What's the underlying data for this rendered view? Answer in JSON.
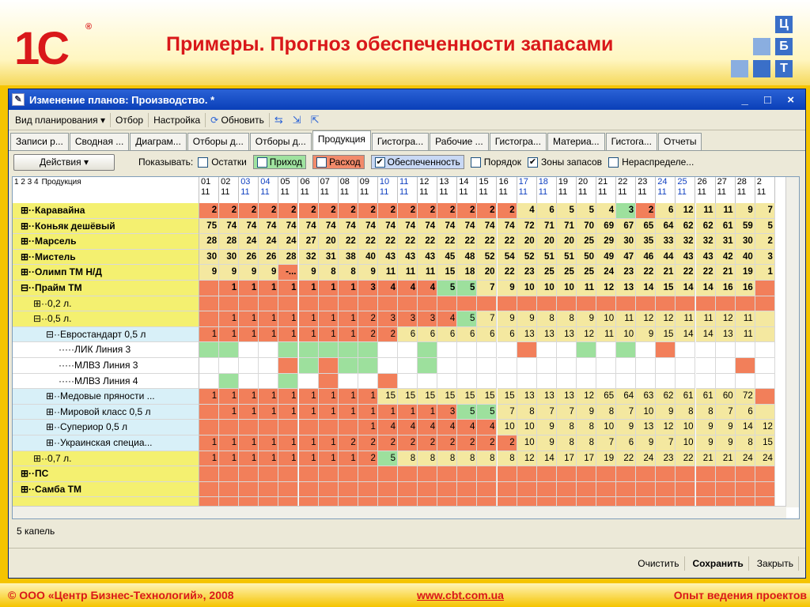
{
  "slide": {
    "logo": "1С",
    "title": "Примеры. Прогноз обеспеченности запасами",
    "cbt": [
      "Ц",
      "Б",
      "Т"
    ],
    "footer_left_pre": "© ООО «",
    "footer_left_bold": "Центр Бизнес-Технологий",
    "footer_left_post": "», 2008",
    "footer_center": "www.cbt.com.ua",
    "footer_right": "Опыт ведения проектов"
  },
  "window": {
    "title": "Изменение планов: Производство.  *",
    "controls": "_ □ ×"
  },
  "menubar": [
    "Вид планирования ▾",
    "Отбор",
    "Настройка",
    "Обновить"
  ],
  "tabs": [
    "Записи р...",
    "Сводная ...",
    "Диаграм...",
    "Отборы д...",
    "Отборы д...",
    "Продукция",
    "Гистогра...",
    "Рабочие ...",
    "Гистогра...",
    "Материа...",
    "Гистога...",
    "Отчеты"
  ],
  "active_tab": 5,
  "filterbar": {
    "actions": "Действия",
    "show_label": "Показывать:",
    "checks": [
      {
        "label": "Остатки",
        "checked": false
      },
      {
        "label": "Приход",
        "checked": false,
        "swatch": "#9fe29f"
      },
      {
        "label": "Расход",
        "checked": false,
        "swatch": "#f28a6a"
      },
      {
        "label": "Обеспеченность",
        "checked": true
      },
      {
        "label": "Порядок",
        "checked": false
      },
      {
        "label": "Зоны запасов",
        "checked": true
      },
      {
        "label": "Нераспределе...",
        "checked": false
      }
    ]
  },
  "grid": {
    "header_label": "Продукция",
    "levels": "1 2 3 4",
    "days": [
      "01",
      "02",
      "03",
      "04",
      "05",
      "06",
      "07",
      "08",
      "09",
      "10",
      "11",
      "12",
      "13",
      "14",
      "15",
      "16",
      "17",
      "18",
      "19",
      "20",
      "21",
      "22",
      "23",
      "24",
      "25",
      "26",
      "27",
      "28",
      "2"
    ],
    "blue_days": [
      "03",
      "04",
      "10",
      "11",
      "17",
      "18",
      "24",
      "25"
    ],
    "month": "11",
    "colors": {
      "R": "#f27f5a",
      "G": "#9de09d",
      "Y": "#f4e8a0",
      "W": "#ffffff",
      "L": "#ffffff"
    },
    "rows": [
      {
        "label": "⊞··Каравайна",
        "indent": 0,
        "bold": true,
        "bg": "#f4f070",
        "vals": [
          "2",
          "2",
          "2",
          "2",
          "2",
          "2",
          "2",
          "2",
          "2",
          "2",
          "2",
          "2",
          "2",
          "2",
          "2",
          "2",
          "4",
          "6",
          "5",
          "5",
          "4",
          "3",
          "2",
          "6",
          "12",
          "11",
          "11",
          "9",
          "7"
        ],
        "c": "RRRRRRRRRRRRRRRRYYYYYGRYYYYYY"
      },
      {
        "label": "⊞··Коньяк   дешёвый",
        "indent": 0,
        "bold": true,
        "bg": "#f4f070",
        "vals": [
          "75",
          "74",
          "74",
          "74",
          "74",
          "74",
          "74",
          "74",
          "74",
          "74",
          "74",
          "74",
          "74",
          "74",
          "74",
          "74",
          "72",
          "71",
          "71",
          "70",
          "69",
          "67",
          "65",
          "64",
          "62",
          "62",
          "61",
          "59",
          "5"
        ],
        "c": "YYYYYYYYYYYYYYYYYYYYYYYYYYYYY"
      },
      {
        "label": "⊞··Марсель",
        "indent": 0,
        "bold": true,
        "bg": "#f4f070",
        "vals": [
          "28",
          "28",
          "24",
          "24",
          "24",
          "27",
          "20",
          "22",
          "22",
          "22",
          "22",
          "22",
          "22",
          "22",
          "22",
          "22",
          "20",
          "20",
          "20",
          "25",
          "29",
          "30",
          "35",
          "33",
          "32",
          "32",
          "31",
          "30",
          "2"
        ],
        "c": "YYYYYYYYYYYYYYYYYYYYYYYYYYYYY"
      },
      {
        "label": "⊞··Мистель",
        "indent": 0,
        "bold": true,
        "bg": "#f4f070",
        "vals": [
          "30",
          "30",
          "26",
          "26",
          "28",
          "32",
          "31",
          "38",
          "40",
          "43",
          "43",
          "43",
          "45",
          "48",
          "52",
          "54",
          "52",
          "51",
          "51",
          "50",
          "49",
          "47",
          "46",
          "44",
          "43",
          "43",
          "42",
          "40",
          "3"
        ],
        "c": "YYYYYYYYYYYYYYYYYYYYYYYYYYYYY"
      },
      {
        "label": "⊞··Олимп ТМ Н/Д",
        "indent": 0,
        "bold": true,
        "bg": "#f4f070",
        "vals": [
          "9",
          "9",
          "9",
          "9",
          "-...",
          "9",
          "8",
          "8",
          "9",
          "11",
          "11",
          "11",
          "15",
          "18",
          "20",
          "22",
          "23",
          "25",
          "25",
          "25",
          "24",
          "23",
          "22",
          "21",
          "22",
          "22",
          "21",
          "19",
          "1"
        ],
        "c": "YYYYRYYYYYYYYYYYYYYYYYYYYYYYY"
      },
      {
        "label": "⊟··Прайм ТМ",
        "indent": 0,
        "bold": true,
        "bg": "#f4f070",
        "vals": [
          "",
          "1",
          "1",
          "1",
          "1",
          "1",
          "1",
          "1",
          "3",
          "4",
          "4",
          "4",
          "5",
          "5",
          "7",
          "9",
          "10",
          "10",
          "10",
          "11",
          "12",
          "13",
          "14",
          "15",
          "14",
          "14",
          "16",
          "16",
          ""
        ],
        "c": "RRRRRRRRRRRRGGYYYYYYYYYYYYYYR"
      },
      {
        "label": "⊞··0,2 л.",
        "indent": 2,
        "bold": false,
        "bg": "#f4f070",
        "vals": [
          "",
          "",
          "",
          "",
          "",
          "",
          "",
          "",
          "",
          "",
          "",
          "",
          "",
          "",
          "",
          "",
          "",
          "",
          "",
          "",
          "",
          "",
          "",
          "",
          "",
          "",
          "",
          "",
          ""
        ],
        "c": "RRRRRRRRRRRRRRRRRRRRRRRRRRRRR"
      },
      {
        "label": "⊟··0,5 л.",
        "indent": 2,
        "bold": false,
        "bg": "#f4f070",
        "vals": [
          "",
          "1",
          "1",
          "1",
          "1",
          "1",
          "1",
          "1",
          "2",
          "3",
          "3",
          "3",
          "4",
          "5",
          "7",
          "9",
          "9",
          "8",
          "8",
          "9",
          "10",
          "11",
          "12",
          "12",
          "11",
          "11",
          "12",
          "11",
          ""
        ],
        "c": "RRRRRRRRRRRRRGYYYYYYYYYYYYYYY"
      },
      {
        "label": "⊟··Евростандарт 0,5 л",
        "indent": 4,
        "bold": false,
        "bg": "#d8f0f8",
        "vals": [
          "1",
          "1",
          "1",
          "1",
          "1",
          "1",
          "1",
          "1",
          "2",
          "2",
          "6",
          "6",
          "6",
          "6",
          "6",
          "6",
          "13",
          "13",
          "13",
          "12",
          "11",
          "10",
          "9",
          "15",
          "14",
          "14",
          "13",
          "11",
          ""
        ],
        "c": "RRRRRRRRRRYYYYYYYYYYYYYYYYYYY"
      },
      {
        "label": "·····ЛИК Линия 3",
        "indent": 6,
        "bold": false,
        "bg": "#ffffff",
        "vals": [
          "",
          "",
          "",
          "",
          "",
          "",
          "",
          "",
          "",
          "",
          "",
          "",
          "",
          "",
          "",
          "",
          "",
          "",
          "",
          "",
          "",
          "",
          "",
          "",
          "",
          "",
          "",
          "",
          ""
        ],
        "c": "GGWWGGGGGWWGWWWWRWWGWGWRWWWWW"
      },
      {
        "label": "·····МЛВЗ Линия 3",
        "indent": 6,
        "bold": false,
        "bg": "#ffffff",
        "vals": [
          "",
          "",
          "",
          "",
          "",
          "",
          "",
          "",
          "",
          "",
          "",
          "",
          "",
          "",
          "",
          "",
          "",
          "",
          "",
          "",
          "",
          "",
          "",
          "",
          "",
          "",
          "",
          "",
          ""
        ],
        "c": "WWWWRGRGGWWGWWWWWWWWWWWWWWWRW"
      },
      {
        "label": "·····МЛВЗ Линия 4",
        "indent": 6,
        "bold": false,
        "bg": "#ffffff",
        "vals": [
          "",
          "",
          "",
          "",
          "",
          "",
          "",
          "",
          "",
          "",
          "",
          "",
          "",
          "",
          "",
          "",
          "",
          "",
          "",
          "",
          "",
          "",
          "",
          "",
          "",
          "",
          "",
          "",
          ""
        ],
        "c": "WGWWGWRWWRWWWWWWWWWWWWWWWWWWW"
      },
      {
        "label": "⊞··Медовые пряности ...",
        "indent": 4,
        "bold": false,
        "bg": "#d8f0f8",
        "vals": [
          "1",
          "1",
          "1",
          "1",
          "1",
          "1",
          "1",
          "1",
          "1",
          "15",
          "15",
          "15",
          "15",
          "15",
          "15",
          "15",
          "13",
          "13",
          "13",
          "12",
          "65",
          "64",
          "63",
          "62",
          "61",
          "61",
          "60",
          "72",
          ""
        ],
        "c": "RRRRRRRRRYYYYYYYYYYYYYYYYYYYR"
      },
      {
        "label": "⊞··Мировой класс 0,5 л",
        "indent": 4,
        "bold": false,
        "bg": "#d8f0f8",
        "vals": [
          "",
          "1",
          "1",
          "1",
          "1",
          "1",
          "1",
          "1",
          "1",
          "1",
          "1",
          "1",
          "3",
          "5",
          "5",
          "7",
          "8",
          "7",
          "7",
          "9",
          "8",
          "7",
          "10",
          "9",
          "8",
          "8",
          "7",
          "6",
          ""
        ],
        "c": "RRRRRRRRRRRRRGGYYYYYYYYYYYYYY"
      },
      {
        "label": "⊞··Супериор 0,5 л",
        "indent": 4,
        "bold": false,
        "bg": "#d8f0f8",
        "vals": [
          "",
          "",
          "",
          "",
          "",
          "",
          "",
          "",
          "1",
          "4",
          "4",
          "4",
          "4",
          "4",
          "4",
          "10",
          "10",
          "9",
          "8",
          "8",
          "10",
          "9",
          "13",
          "12",
          "10",
          "9",
          "9",
          "14",
          "12"
        ],
        "c": "RRRRRRRRRRRRRRRYYYYYYYYYYYYYY"
      },
      {
        "label": "⊞··Украинская специа...",
        "indent": 4,
        "bold": false,
        "bg": "#d8f0f8",
        "vals": [
          "1",
          "1",
          "1",
          "1",
          "1",
          "1",
          "1",
          "2",
          "2",
          "2",
          "2",
          "2",
          "2",
          "2",
          "2",
          "2",
          "10",
          "9",
          "8",
          "8",
          "7",
          "6",
          "9",
          "7",
          "10",
          "9",
          "9",
          "8",
          "15"
        ],
        "c": "RRRRRRRRRRRRRRRRYYYYYYYYYYYYY"
      },
      {
        "label": "⊞··0,7 л.",
        "indent": 2,
        "bold": false,
        "bg": "#f4f070",
        "vals": [
          "1",
          "1",
          "1",
          "1",
          "1",
          "1",
          "1",
          "1",
          "2",
          "5",
          "8",
          "8",
          "8",
          "8",
          "8",
          "8",
          "12",
          "14",
          "17",
          "17",
          "19",
          "22",
          "24",
          "23",
          "22",
          "21",
          "21",
          "24",
          "24"
        ],
        "c": "RRRRRRRRRGYYYYYYYYYYYYYYYYYYY"
      },
      {
        "label": "⊞··ПС",
        "indent": 0,
        "bold": true,
        "bg": "#f4f070",
        "vals": [
          "",
          "",
          "",
          "",
          "",
          "",
          "",
          "",
          "",
          "",
          "",
          "",
          "",
          "",
          "",
          "",
          "",
          "",
          "",
          "",
          "",
          "",
          "",
          "",
          "",
          "",
          "",
          "",
          ""
        ],
        "c": "RRRRRRRRRRRRRRRRRRRRRRRRRRRRR"
      },
      {
        "label": "⊞··Самба ТМ",
        "indent": 0,
        "bold": true,
        "bg": "#f4f070",
        "vals": [
          "",
          "",
          "",
          "",
          "",
          "",
          "",
          "",
          "",
          "",
          "",
          "",
          "",
          "",
          "",
          "",
          "",
          "",
          "",
          "",
          "",
          "",
          "",
          "",
          "",
          "",
          "",
          "",
          ""
        ],
        "c": "RRRRRRRRRRRRRRRRRRRRRRRRRRRRR"
      },
      {
        "label": "",
        "indent": 0,
        "bold": false,
        "bg": "#f4f070",
        "vals": [
          "",
          "",
          "",
          "",
          "",
          "",
          "",
          "",
          "",
          "",
          "",
          "",
          "",
          "",
          "",
          "",
          "",
          "",
          "",
          "",
          "",
          "",
          "",
          "",
          "",
          "",
          "",
          "",
          ""
        ],
        "c": "RRRRRRRRRRRRRRRRRRRRRRRRRRRRR"
      }
    ]
  },
  "status": "5 капель",
  "bottombar": [
    "Очистить",
    "Сохранить",
    "Закрыть"
  ]
}
